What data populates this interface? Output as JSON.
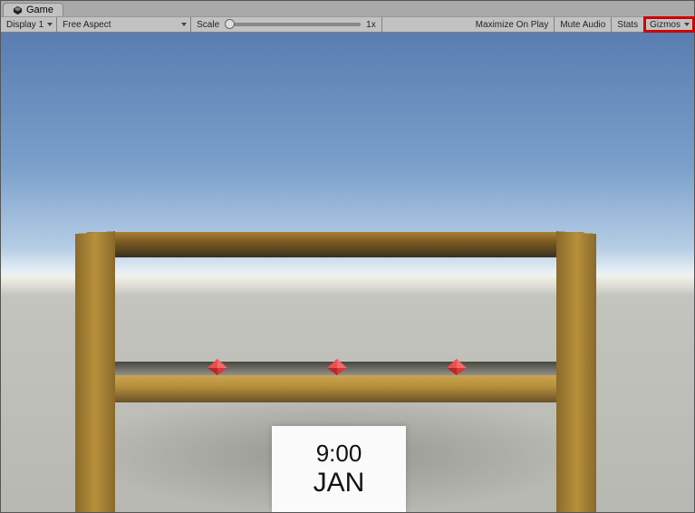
{
  "tab": {
    "label": "Game"
  },
  "toolbar": {
    "display": "Display 1",
    "aspect": "Free Aspect",
    "scale_label": "Scale",
    "scale_value": "1x",
    "maximize": "Maximize On Play",
    "mute": "Mute Audio",
    "stats": "Stats",
    "gizmos": "Gizmos"
  },
  "placard": {
    "time": "9:00",
    "month": "JAN"
  },
  "icons": {
    "game_tab": "unity-logo-icon",
    "gems": "gizmo-gem-icon"
  }
}
